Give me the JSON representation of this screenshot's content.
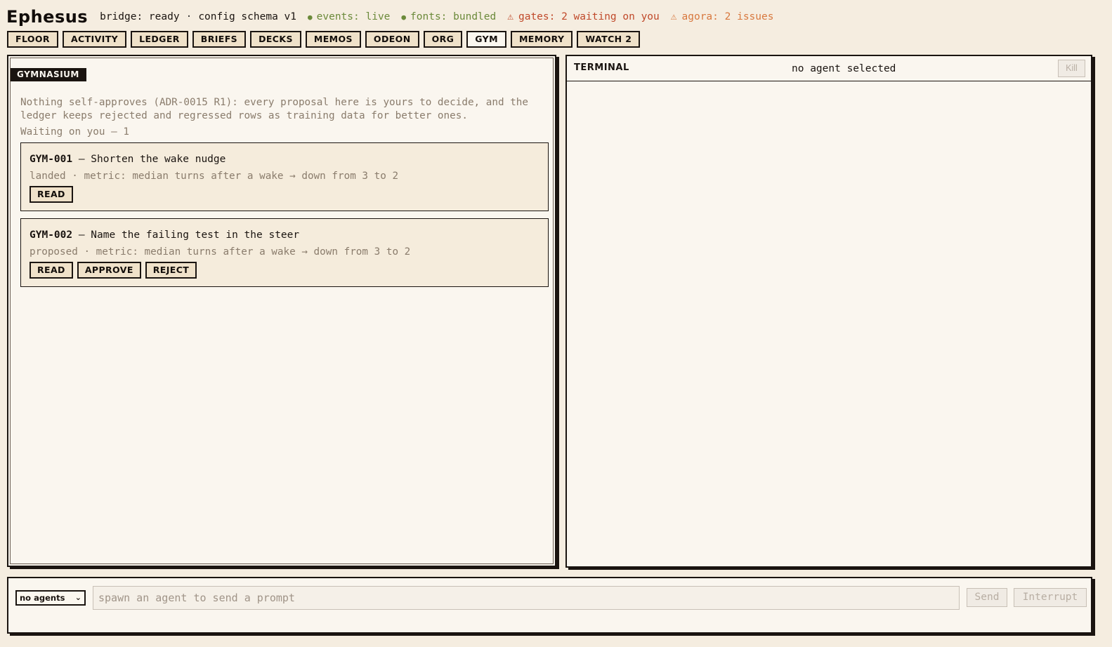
{
  "app": {
    "title": "Ephesus",
    "bridge": "bridge: ready",
    "config": "config schema v1",
    "separator": "·",
    "events": "events: live",
    "fonts": "fonts: bundled",
    "gates": "gates: 2 waiting on you",
    "agora": "agora: 2 issues",
    "colors": {
      "ok": "#6b8a3a",
      "warn": "#c0492a",
      "warn2": "#d8783e"
    }
  },
  "tabs": [
    {
      "label": "FLOOR"
    },
    {
      "label": "ACTIVITY"
    },
    {
      "label": "LEDGER"
    },
    {
      "label": "BRIEFS"
    },
    {
      "label": "DECKS"
    },
    {
      "label": "MEMOS"
    },
    {
      "label": "ODEON"
    },
    {
      "label": "ORG"
    },
    {
      "label": "GYM",
      "active": true
    },
    {
      "label": "MEMORY"
    },
    {
      "label": "WATCH 2"
    }
  ],
  "gym": {
    "section": "GYMNASIUM",
    "intro": "Nothing self-approves (ADR-0015 R1): every proposal here is yours to decide, and the ledger keeps rejected and regressed rows as training data for better ones.",
    "waiting": "Waiting on you — 1",
    "items": [
      {
        "id": "GYM-001",
        "title": "— Shorten the wake nudge",
        "meta": "landed · metric: median turns after a wake → down from 3 to 2",
        "actions": [
          "READ"
        ]
      },
      {
        "id": "GYM-002",
        "title": "— Name the failing test in the steer",
        "meta": "proposed · metric: median turns after a wake → down from 3 to 2",
        "actions": [
          "READ",
          "APPROVE",
          "REJECT"
        ]
      }
    ]
  },
  "terminal": {
    "title": "TERMINAL",
    "status": "no agent selected",
    "kill_label": "Kill"
  },
  "composer": {
    "agent_select": "no agents",
    "placeholder": "spawn an agent to send a prompt",
    "send_label": "Send",
    "interrupt_label": "Interrupt"
  }
}
